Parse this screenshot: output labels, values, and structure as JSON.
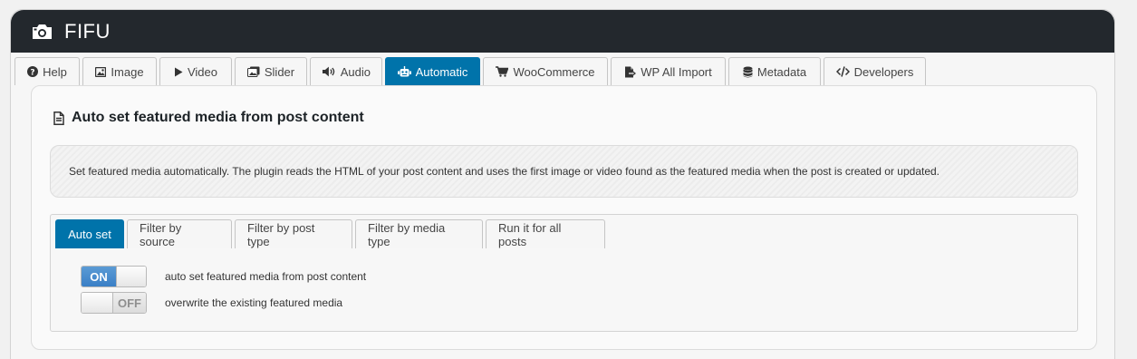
{
  "header": {
    "title": "FIFU",
    "icon": "camera-icon"
  },
  "tabs": [
    {
      "label": "Help",
      "icon": "question-circle-icon"
    },
    {
      "label": "Image",
      "icon": "image-icon"
    },
    {
      "label": "Video",
      "icon": "play-icon"
    },
    {
      "label": "Slider",
      "icon": "images-icon"
    },
    {
      "label": "Audio",
      "icon": "speaker-icon"
    },
    {
      "label": "Automatic",
      "icon": "robot-icon"
    },
    {
      "label": "WooCommerce",
      "icon": "cart-icon"
    },
    {
      "label": "WP All Import",
      "icon": "file-import-icon"
    },
    {
      "label": "Metadata",
      "icon": "database-icon"
    },
    {
      "label": "Developers",
      "icon": "code-icon"
    }
  ],
  "active_tab": "Automatic",
  "section": {
    "title": "Auto set featured media from post content",
    "icon": "document-icon",
    "note": "Set featured media automatically. The plugin reads the HTML of your post content and uses the first image or video found as the featured media when the post is created or updated."
  },
  "subtabs": [
    "Auto set",
    "Filter by source",
    "Filter by post type",
    "Filter by media type",
    "Run it for all posts"
  ],
  "active_subtab": "Auto set",
  "options": [
    {
      "state": "ON",
      "label": "auto set featured media from post content"
    },
    {
      "state": "OFF",
      "label": "overwrite the existing featured media"
    }
  ],
  "colors": {
    "header_bg": "#23282d",
    "accent": "#0073aa",
    "toggle_on": "#4a8ccf"
  }
}
